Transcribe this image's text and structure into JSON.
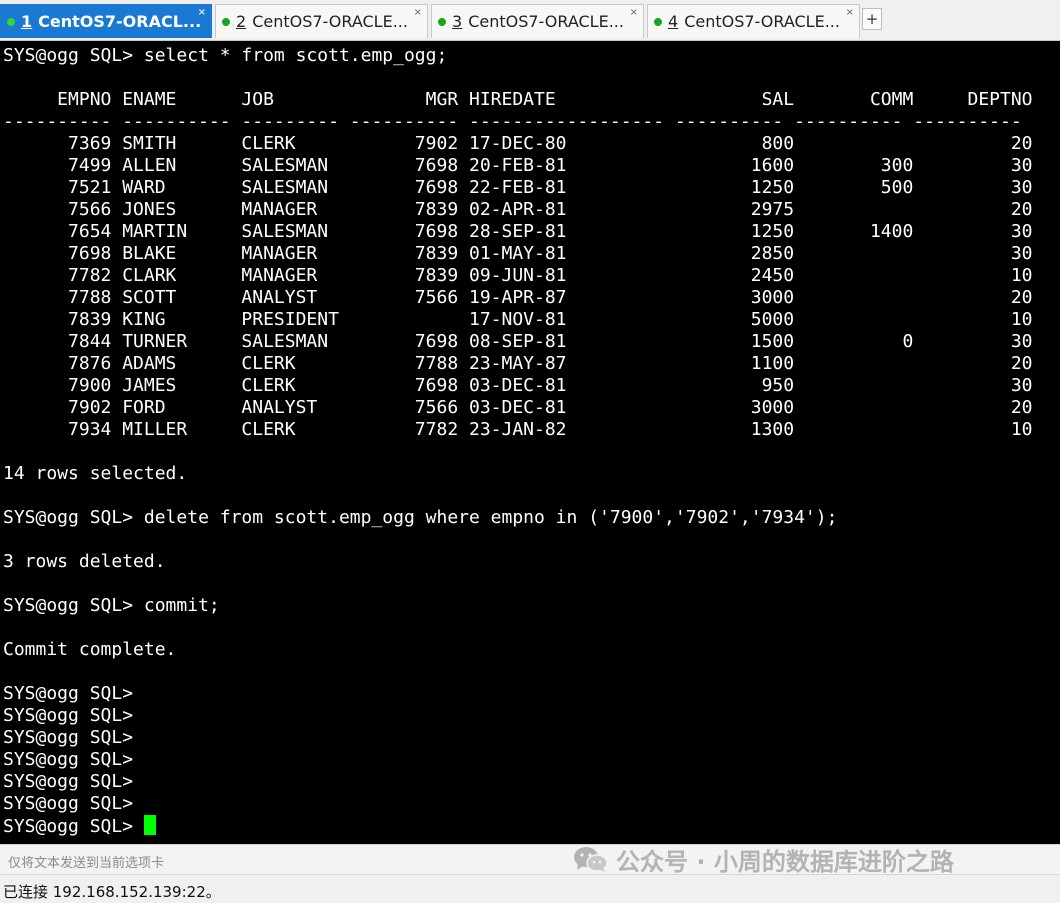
{
  "tabs": [
    {
      "num": "1",
      "label": "CentOS7-ORACL...",
      "active": true
    },
    {
      "num": "2",
      "label": "CentOS7-ORACLE...",
      "active": false
    },
    {
      "num": "3",
      "label": "CentOS7-ORACLE...",
      "active": false
    },
    {
      "num": "4",
      "label": "CentOS7-ORACLE...",
      "active": false
    }
  ],
  "tab_close_glyph": "×",
  "tab_add_glyph": "+",
  "terminal": {
    "lines": [
      "SYS@ogg SQL> select * from scott.emp_ogg;",
      "",
      "     EMPNO ENAME      JOB              MGR HIREDATE                   SAL       COMM     DEPTNO",
      "---------- ---------- --------- ---------- ------------------ ---------- ---------- ----------",
      "      7369 SMITH      CLERK           7902 17-DEC-80                  800                    20",
      "      7499 ALLEN      SALESMAN        7698 20-FEB-81                 1600        300         30",
      "      7521 WARD       SALESMAN        7698 22-FEB-81                 1250        500         30",
      "      7566 JONES      MANAGER         7839 02-APR-81                 2975                    20",
      "      7654 MARTIN     SALESMAN        7698 28-SEP-81                 1250       1400         30",
      "      7698 BLAKE      MANAGER         7839 01-MAY-81                 2850                    30",
      "      7782 CLARK      MANAGER         7839 09-JUN-81                 2450                    10",
      "      7788 SCOTT      ANALYST         7566 19-APR-87                 3000                    20",
      "      7839 KING       PRESIDENT            17-NOV-81                 5000                    10",
      "      7844 TURNER     SALESMAN        7698 08-SEP-81                 1500          0         30",
      "      7876 ADAMS      CLERK           7788 23-MAY-87                 1100                    20",
      "      7900 JAMES      CLERK           7698 03-DEC-81                  950                    30",
      "      7902 FORD       ANALYST         7566 03-DEC-81                 3000                    20",
      "      7934 MILLER     CLERK           7782 23-JAN-82                 1300                    10",
      "",
      "14 rows selected.",
      "",
      "SYS@ogg SQL> delete from scott.emp_ogg where empno in ('7900','7902','7934');",
      "",
      "3 rows deleted.",
      "",
      "SYS@ogg SQL> commit;",
      "",
      "Commit complete.",
      "",
      "SYS@ogg SQL>",
      "SYS@ogg SQL>",
      "SYS@ogg SQL>",
      "SYS@ogg SQL>",
      "SYS@ogg SQL>",
      "SYS@ogg SQL>",
      "SYS@ogg SQL> "
    ],
    "cursor_color": "#00ff00",
    "background": "#000000",
    "foreground": "#ffffff"
  },
  "hint_bar": {
    "text": "仅将文本发送到当前选项卡"
  },
  "watermark": {
    "icon": "wechat-icon",
    "text": "公众号 · 小周的数据库进阶之路"
  },
  "status_bar": {
    "text": "已连接 192.168.152.139:22。"
  },
  "colors": {
    "active_tab": "#1979d3",
    "tab_dot": "#1aa51a"
  }
}
